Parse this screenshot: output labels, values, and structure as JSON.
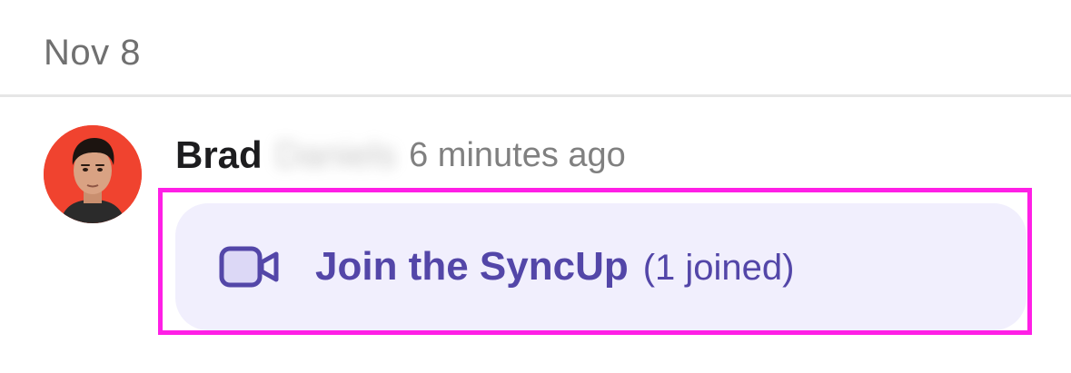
{
  "feed": {
    "date_header": "Nov 8"
  },
  "message": {
    "author_first_name": "Brad",
    "author_last_name": "Daniels",
    "timestamp": "6 minutes ago",
    "avatar_icon": "person-avatar-icon",
    "avatar_color": "#f0432f"
  },
  "syncup_card": {
    "label": "Join the SyncUp",
    "joined_count": "(1 joined)",
    "icon": "video-camera-icon",
    "accent_color": "#5346a8",
    "background_color": "#f1effd"
  },
  "highlight_color": "#ff1fe6"
}
